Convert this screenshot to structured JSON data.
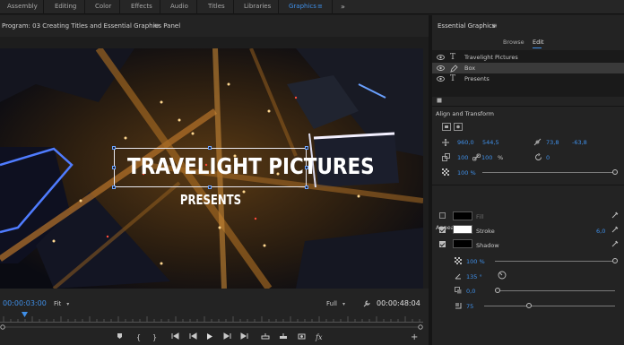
{
  "workspace_tabs": [
    {
      "label": "Assembly"
    },
    {
      "label": "Editing"
    },
    {
      "label": "Color"
    },
    {
      "label": "Effects"
    },
    {
      "label": "Audio"
    },
    {
      "label": "Titles"
    },
    {
      "label": "Libraries"
    },
    {
      "label": "Graphics",
      "active": true
    }
  ],
  "workspace_menu_glyph": "≡",
  "more_glyph": "»",
  "program": {
    "title": "Program: 03 Creating Titles and Essential Graphics Panel",
    "menu_glyph": "≡",
    "title_text": "TRAVELIGHT PICTURES",
    "subtitle_text": "PRESENTS",
    "timecode_current": "00:00:03:00",
    "timecode_duration": "00:00:48:04",
    "zoom_value": "Fit",
    "resolution_value": "Full",
    "caret": "▾",
    "playhead_position": 0.05
  },
  "essential_graphics": {
    "title": "Essential Graphics",
    "menu_glyph": "≡",
    "tabs": {
      "browse": "Browse",
      "edit": "Edit"
    },
    "layers": [
      {
        "name": "Travelight Pictures",
        "type_icon": "T",
        "visible": true,
        "selected": false
      },
      {
        "name": "Box",
        "type_icon": "shape",
        "visible": true,
        "selected": true
      },
      {
        "name": "Presents",
        "type_icon": "T",
        "visible": true,
        "selected": false
      }
    ],
    "align_transform": {
      "title": "Align and Transform",
      "position_x": "960,0",
      "position_y": "544,5",
      "anchor_x": "73,8",
      "anchor_y": "-63,8",
      "scale_w": "100",
      "scale_h": "100",
      "scale_unit": "%",
      "rotation": "0",
      "opacity": "100 %",
      "opacity_fraction": 1.0
    },
    "appearance": {
      "title": "Appearance",
      "fill": {
        "label": "Fill",
        "checked": false,
        "color": "#000000"
      },
      "stroke": {
        "label": "Stroke",
        "checked": true,
        "color": "#ffffff",
        "width": "6,0"
      },
      "shadow": {
        "label": "Shadow",
        "checked": true,
        "color": "#000000"
      },
      "shadow_opacity": "100 %",
      "shadow_opacity_fraction": 1.0,
      "shadow_angle": "135 °",
      "shadow_distance": "0,0",
      "shadow_distance_fraction": 0.0,
      "shadow_size": "75",
      "shadow_size_fraction": 0.34
    }
  },
  "colors": {
    "accent": "#3f8fe8",
    "panel_bg": "#232323",
    "stroke_color": "#ffffff"
  }
}
